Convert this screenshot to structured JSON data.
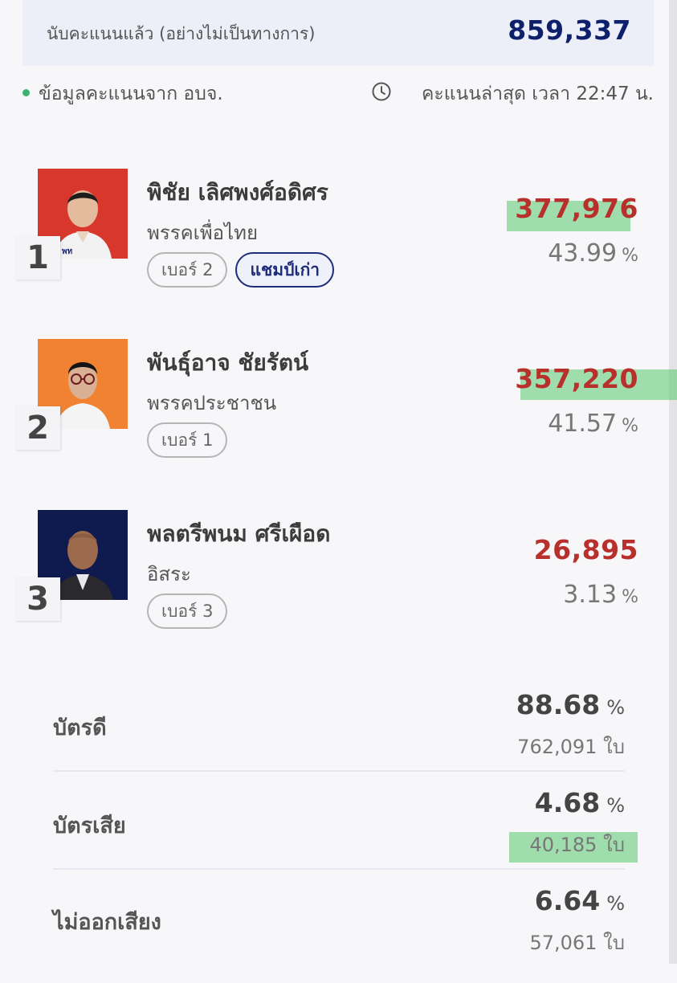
{
  "summary": {
    "counted_label": "นับคะแนนแล้ว (อย่างไม่เป็นทางการ)",
    "counted_value": "859,337",
    "source_text": "ข้อมูลคะแนนจาก อบจ.",
    "latest_text": "คะแนนล่าสุด เวลา 22:47 น."
  },
  "candidates": [
    {
      "rank": "1",
      "name": "พิชัย เลิศพงศ์อดิศร",
      "party": "พรรคเพื่อไทย",
      "number_tag": "เบอร์ 2",
      "champ_tag": "แชมป์เก่า",
      "votes": "377,976",
      "percent": "43.99",
      "percent_unit": "%",
      "photo_bg": "#d8382c"
    },
    {
      "rank": "2",
      "name": "พันธุ์อาจ ชัยรัตน์",
      "party": "พรรคประชาชน",
      "number_tag": "เบอร์ 1",
      "votes": "357,220",
      "percent": "41.57",
      "percent_unit": "%",
      "photo_bg": "#f08232"
    },
    {
      "rank": "3",
      "name": "พลตรีพนม ศรีเผือด",
      "party": "อิสระ",
      "number_tag": "เบอร์ 3",
      "votes": "26,895",
      "percent": "3.13",
      "percent_unit": "%",
      "photo_bg": "#0f1a4e"
    }
  ],
  "ballots": [
    {
      "label": "บัตรดี",
      "percent": "88.68",
      "unit": "%",
      "count": "762,091 ใบ"
    },
    {
      "label": "บัตรเสีย",
      "percent": "4.68",
      "unit": "%",
      "count": "40,185 ใบ"
    },
    {
      "label": "ไม่ออกเสียง",
      "percent": "6.64",
      "unit": "%",
      "count": "57,061 ใบ"
    }
  ],
  "colors": {
    "accent_navy": "#0e1f6b",
    "vote_red": "#b8302c",
    "highlight_green": "#5ac86e",
    "status_dot_green": "#3bb36b"
  }
}
